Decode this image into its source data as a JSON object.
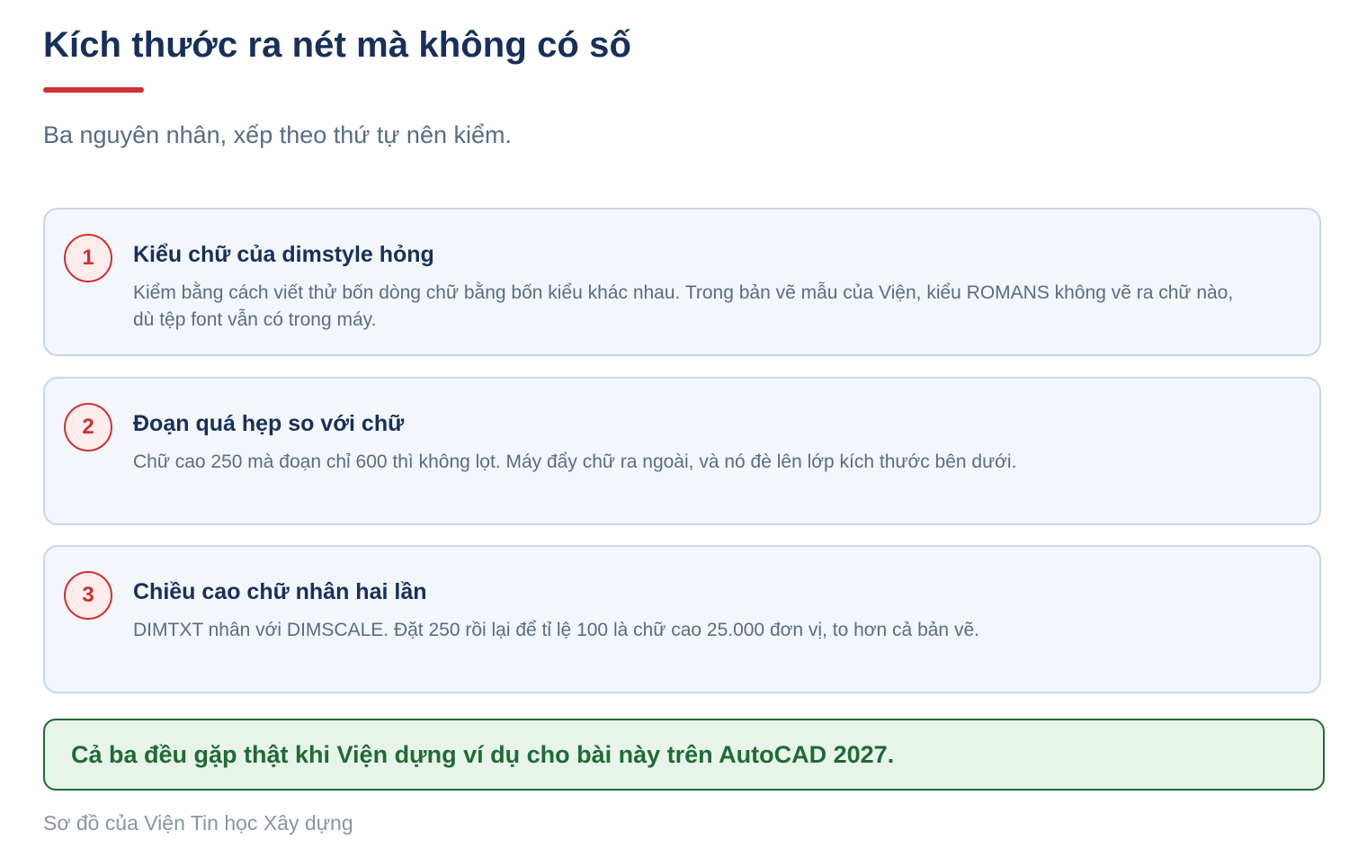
{
  "title": "Kích thước ra nét mà không có số",
  "subtitle": "Ba nguyên nhân, xếp theo thứ tự nên kiểm.",
  "causes": [
    {
      "number": "1",
      "title": "Kiểu chữ của dimstyle hỏng",
      "body": "Kiểm bằng cách viết thử bốn dòng chữ bằng bốn kiểu khác nhau. Trong bản vẽ mẫu của Viện, kiểu ROMANS không vẽ ra chữ nào, dù tệp font vẫn có trong máy."
    },
    {
      "number": "2",
      "title": "Đoạn quá hẹp so với chữ",
      "body": "Chữ cao 250 mà đoạn chỉ 600 thì không lọt. Máy đẩy chữ ra ngoài, và nó đè lên lớp kích thước bên dưới."
    },
    {
      "number": "3",
      "title": "Chiều cao chữ nhân hai lần",
      "body": "DIMTXT nhân với DIMSCALE. Đặt 250 rồi lại để tỉ lệ 100 là chữ cao 25.000 đơn vị, to hơn cả bản vẽ."
    }
  ],
  "callout": "Cả ba đều gặp thật khi Viện dựng ví dụ cho bài này trên AutoCAD 2027.",
  "footer": "Sơ đồ của Viện Tin học Xây dựng",
  "colors": {
    "heading": "#17305a",
    "accent_red": "#d03030",
    "muted_text": "#5a6b85",
    "card_border": "#c8d6e8",
    "card_bg": "#f3f7fc",
    "callout_green": "#1f6b34",
    "callout_bg": "#e8f4ea"
  }
}
